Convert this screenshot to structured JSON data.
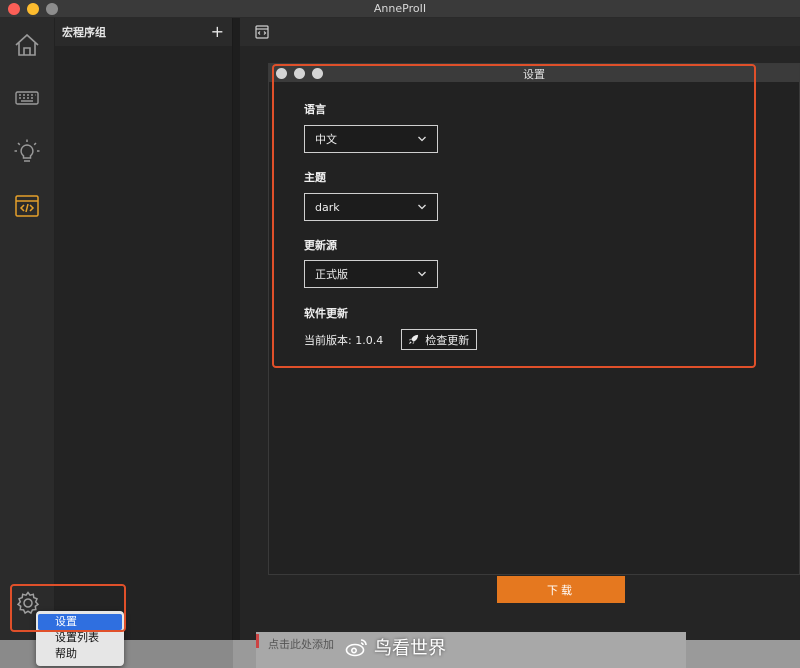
{
  "app": {
    "title": "AnneProII"
  },
  "groups": {
    "title": "宏程序组",
    "add_symbol": "+"
  },
  "sidebar": {
    "items": [
      {
        "icon": "home-icon"
      },
      {
        "icon": "keyboard-icon"
      },
      {
        "icon": "lightbulb-icon"
      },
      {
        "icon": "code-icon",
        "active": true
      }
    ],
    "accent_color": "#e5a02a"
  },
  "settings": {
    "title": "设置",
    "language": {
      "label": "语言",
      "value": "中文"
    },
    "theme": {
      "label": "主题",
      "value": "dark"
    },
    "update_source": {
      "label": "更新源",
      "value": "正式版"
    },
    "software_update": {
      "label": "软件更新",
      "version_text": "当前版本: 1.0.4",
      "check_button": "检查更新"
    }
  },
  "download_button": "下载",
  "context_menu": {
    "items": [
      "设置",
      "设置列表",
      "帮助"
    ],
    "selected_index": 0
  },
  "bottom": {
    "hint": "点击此处添加"
  },
  "watermark": {
    "text": "鸟看世界"
  },
  "colors": {
    "highlight": "#e0502a",
    "download": "#e5781f",
    "menu_selected": "#2f6fe0"
  }
}
